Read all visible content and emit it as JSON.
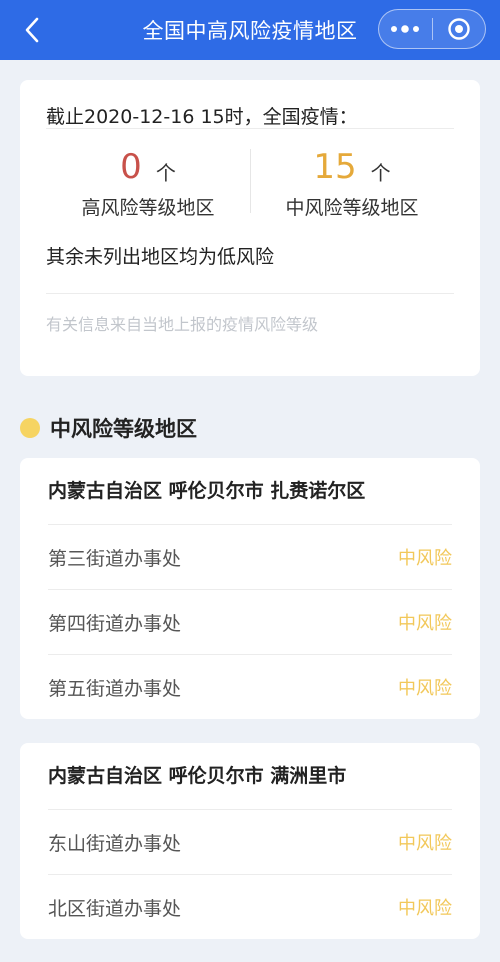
{
  "header": {
    "title": "全国中高风险疫情地区"
  },
  "summary": {
    "headline": "截止2020-12-16 15时，全国疫情：",
    "high": {
      "count": "0",
      "unit": "个",
      "label": "高风险等级地区"
    },
    "medium": {
      "count": "15",
      "unit": "个",
      "label": "中风险等级地区"
    },
    "rest": "其余未列出地区均为低风险",
    "source": "有关信息来自当地上报的疫情风险等级"
  },
  "section": {
    "title": "中风险等级地区"
  },
  "regions": [
    {
      "title": "内蒙古自治区 呼伦贝尔市 扎赉诺尔区",
      "items": [
        {
          "name": "第三街道办事处",
          "risk": "中风险"
        },
        {
          "name": "第四街道办事处",
          "risk": "中风险"
        },
        {
          "name": "第五街道办事处",
          "risk": "中风险"
        }
      ]
    },
    {
      "title": "内蒙古自治区 呼伦贝尔市 满洲里市",
      "items": [
        {
          "name": "东山街道办事处",
          "risk": "中风险"
        },
        {
          "name": "北区街道办事处",
          "risk": "中风险"
        }
      ]
    }
  ],
  "colors": {
    "accent": "#2E6BE6",
    "high": "#C8514A",
    "medium": "#E5A93A",
    "risk_text": "#F2C85A",
    "dot": "#F6D462"
  },
  "icons": {
    "back": "chevron-left-icon",
    "more": "more-dots-icon",
    "close": "target-circle-icon"
  }
}
